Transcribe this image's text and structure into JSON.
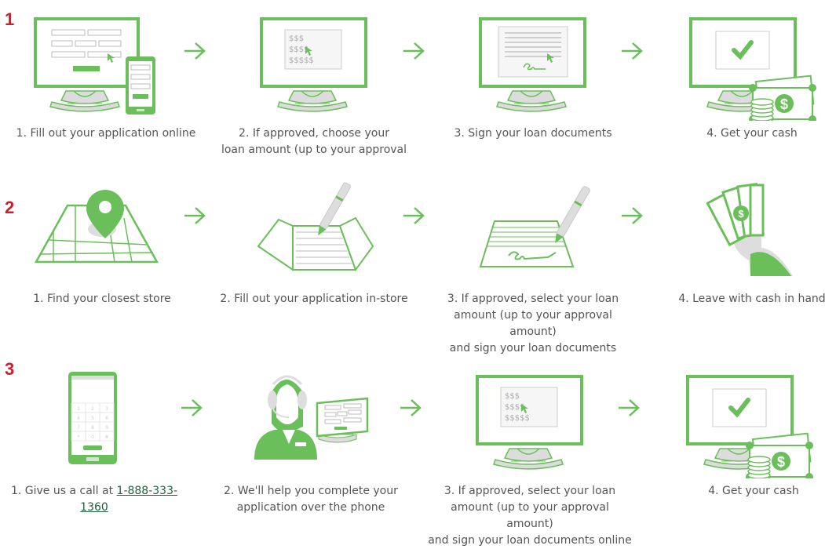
{
  "colors": {
    "accent": "#6abf5a",
    "row_number": "#cc1f2d",
    "text": "#555555",
    "link": "#1f5f3f",
    "gray": "#d9d9d9"
  },
  "rows": [
    {
      "number": "1",
      "steps": [
        {
          "icon": "monitor-and-phone-form-icon",
          "caption": "1. Fill out your application online"
        },
        {
          "icon": "monitor-loan-amount-icon",
          "caption_lines": [
            "2. If approved, choose your",
            "loan amount (up to your approval"
          ]
        },
        {
          "icon": "monitor-sign-document-icon",
          "caption": "3. Sign your loan documents"
        },
        {
          "icon": "monitor-check-cash-icon",
          "caption": "4. Get your cash"
        }
      ]
    },
    {
      "number": "2",
      "steps": [
        {
          "icon": "map-pin-icon",
          "caption": "1. Find your closest store"
        },
        {
          "icon": "pen-on-form-icon",
          "caption": "2. Fill out your application in-store"
        },
        {
          "icon": "pen-signing-document-icon",
          "caption_lines": [
            "3. If approved, select your loan",
            "amount (up to your approval amount)",
            "and sign your loan documents"
          ]
        },
        {
          "icon": "hand-holding-cash-icon",
          "caption": "4. Leave with cash in hand"
        }
      ]
    },
    {
      "number": "3",
      "steps": [
        {
          "icon": "smartphone-dialpad-icon",
          "caption_prefix": "1. Give us a call at ",
          "phone": "1-888-333-1360"
        },
        {
          "icon": "call-center-agent-icon",
          "caption_lines": [
            "2. We'll help you complete your",
            "application over the phone"
          ]
        },
        {
          "icon": "monitor-loan-amount-icon",
          "caption_lines": [
            "3. If approved, select your loan",
            "amount (up to your approval amount)",
            "and sign your loan documents online"
          ]
        },
        {
          "icon": "monitor-check-cash-icon",
          "caption": "4. Get your cash"
        }
      ]
    }
  ],
  "monitor_text": {
    "line1": "$$$",
    "line2": "$$$$",
    "line3": "$$$$$"
  },
  "dialpad_keys": [
    "1",
    "2",
    "3",
    "4",
    "5",
    "6",
    "7",
    "8",
    "9",
    "*",
    "0",
    "#"
  ]
}
